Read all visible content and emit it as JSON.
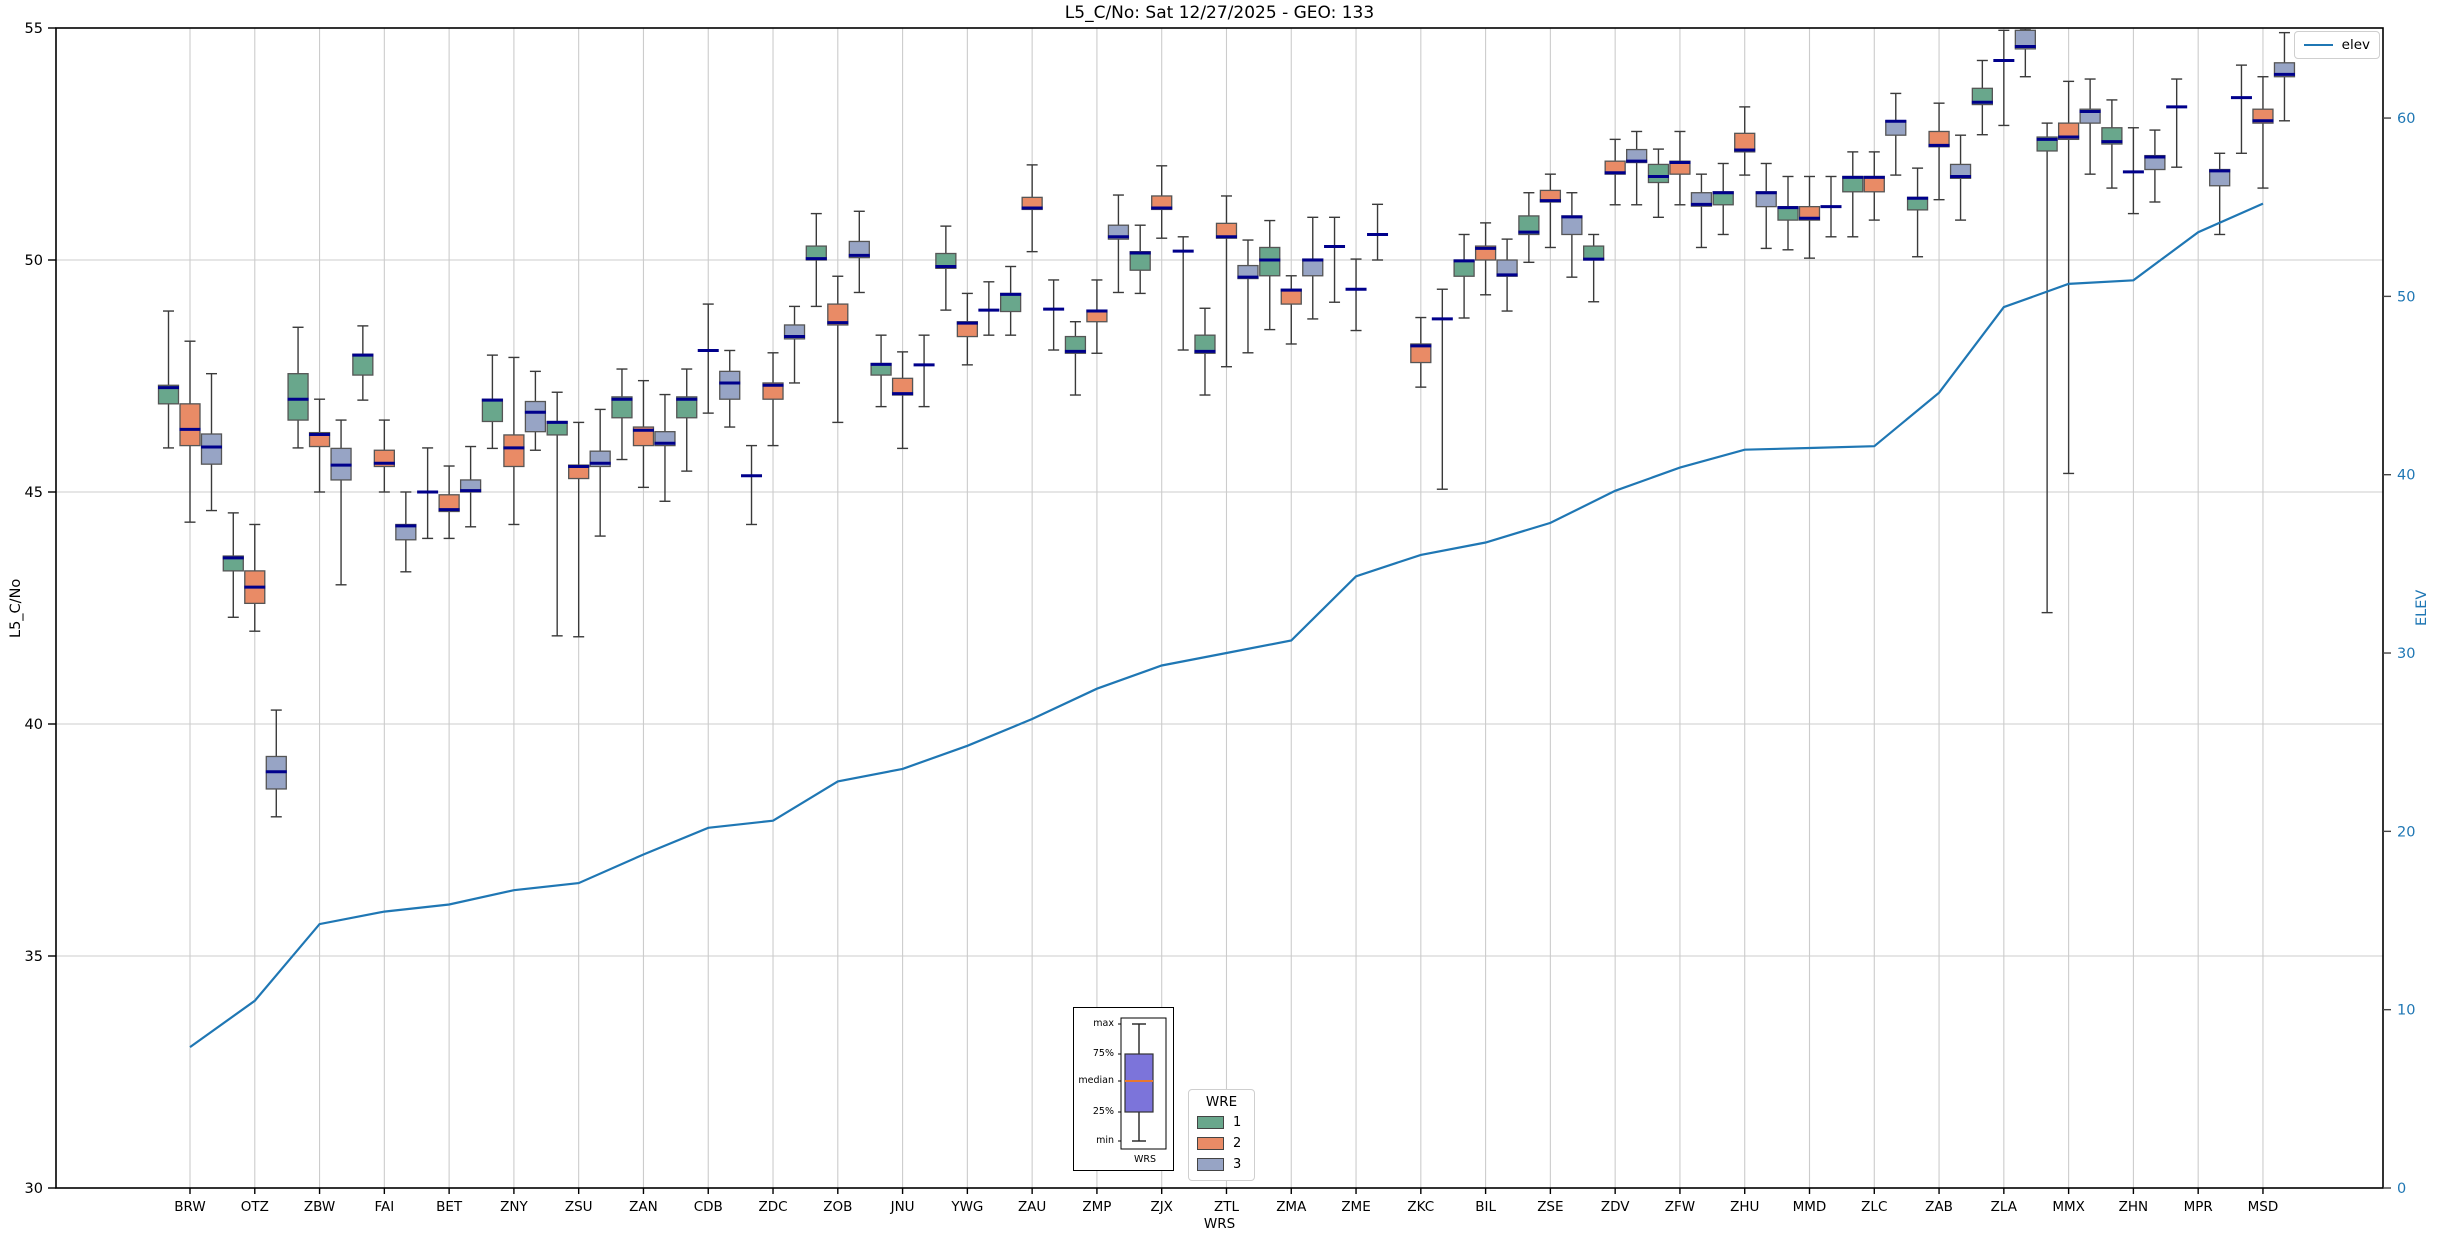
{
  "title": "L5_C/No: Sat 12/27/2025 - GEO: 133",
  "colors": {
    "wre1": "#69a78c",
    "wre2": "#e98b66",
    "wre3": "#97a4c5",
    "median": "#00008b",
    "whisker": "#3a3a3a",
    "box_edge": "#555555",
    "grid": "#cccccc",
    "elev_line": "#1f77b4",
    "right_axis_text": "#1f77b4",
    "inner_box_fill": "#7c74da",
    "inner_median": "#e8772e"
  },
  "legend_elev": {
    "label": "elev"
  },
  "legend_wre": {
    "title": "WRE",
    "items": [
      {
        "label": "1",
        "color_key": "wre1"
      },
      {
        "label": "2",
        "color_key": "wre2"
      },
      {
        "label": "3",
        "color_key": "wre3"
      }
    ]
  },
  "inner_legend": {
    "labels": {
      "max": "max",
      "p75": "75%",
      "median": "median",
      "p25": "25%",
      "min": "min",
      "xlabel": "WRS"
    }
  },
  "chart_data": {
    "type": "box",
    "title": "L5_C/No: Sat 12/27/2025 - GEO: 133",
    "xlabel": "WRS",
    "ylabel_left": "L5_C/No",
    "ylabel_right": "ELEV",
    "ylim_left": [
      30,
      55
    ],
    "ylim_right": [
      0,
      65.05
    ],
    "yticks_left": [
      30,
      35,
      40,
      45,
      50,
      55
    ],
    "yticks_right": [
      0,
      10,
      20,
      30,
      40,
      50,
      60
    ],
    "grid": true,
    "categories": [
      "BRW",
      "OTZ",
      "ZBW",
      "FAI",
      "BET",
      "ZNY",
      "ZSU",
      "ZAN",
      "CDB",
      "ZDC",
      "ZOB",
      "JNU",
      "YWG",
      "ZAU",
      "ZMP",
      "ZJX",
      "ZTL",
      "ZMA",
      "ZME",
      "ZKC",
      "BIL",
      "ZSE",
      "ZDV",
      "ZFW",
      "ZHU",
      "MMD",
      "ZLC",
      "ZAB",
      "ZLA",
      "MMX",
      "ZHN",
      "MPR",
      "MSD"
    ],
    "box_order": [
      "min",
      "q1",
      "median",
      "q3",
      "max"
    ],
    "series": [
      {
        "name": "1",
        "color_key": "wre1",
        "boxes": [
          [
            45.95,
            46.9,
            47.25,
            47.3,
            48.9
          ],
          [
            42.3,
            43.3,
            43.58,
            43.62,
            44.55
          ],
          [
            45.95,
            46.55,
            47.0,
            47.55,
            48.55
          ],
          [
            46.98,
            47.52,
            47.95,
            47.97,
            48.58
          ],
          [
            44.0,
            45.0,
            45.0,
            45.0,
            45.95
          ],
          [
            45.94,
            46.52,
            46.98,
            47.0,
            47.95
          ],
          [
            41.9,
            46.23,
            46.5,
            46.52,
            47.15
          ],
          [
            45.7,
            46.6,
            47.0,
            47.05,
            47.65
          ],
          [
            45.45,
            46.6,
            47.0,
            47.05,
            47.65
          ],
          [
            44.3,
            45.35,
            45.35,
            45.35,
            46.0
          ],
          [
            49.0,
            50.0,
            50.03,
            50.3,
            51.0
          ],
          [
            46.84,
            47.52,
            47.75,
            47.77,
            48.38
          ],
          [
            48.92,
            49.82,
            49.86,
            50.14,
            50.73
          ],
          [
            48.38,
            48.89,
            49.26,
            49.28,
            49.86
          ],
          [
            47.09,
            47.99,
            48.03,
            48.35,
            48.67
          ],
          [
            49.28,
            49.78,
            50.15,
            50.18,
            50.75
          ],
          [
            47.09,
            47.99,
            48.03,
            48.38,
            48.96
          ],
          [
            48.5,
            49.66,
            50.0,
            50.27,
            50.85
          ],
          [
            49.09,
            50.29,
            50.29,
            50.29,
            50.92
          ],
          null,
          [
            48.75,
            49.65,
            49.98,
            50.0,
            50.55
          ],
          [
            49.95,
            50.55,
            50.6,
            50.95,
            51.45
          ],
          [
            49.1,
            50.0,
            50.02,
            50.3,
            50.55
          ],
          [
            50.92,
            51.67,
            51.8,
            52.06,
            52.39
          ],
          [
            50.55,
            51.19,
            51.45,
            51.47,
            52.08
          ],
          [
            50.22,
            50.86,
            51.13,
            51.15,
            51.8
          ],
          [
            50.5,
            51.47,
            51.78,
            51.8,
            52.33
          ],
          [
            50.07,
            51.08,
            51.33,
            51.35,
            51.98
          ],
          [
            52.7,
            53.35,
            53.4,
            53.7,
            54.3
          ],
          [
            42.4,
            52.35,
            52.6,
            52.65,
            52.95
          ],
          [
            51.55,
            52.5,
            52.55,
            52.85,
            53.45
          ],
          [
            52.0,
            53.3,
            53.3,
            53.3,
            53.9
          ],
          [
            52.3,
            53.5,
            53.5,
            53.5,
            54.2
          ]
        ]
      },
      {
        "name": "2",
        "color_key": "wre2",
        "boxes": [
          [
            44.35,
            46.0,
            46.35,
            46.9,
            48.25
          ],
          [
            42.0,
            42.6,
            42.95,
            43.3,
            44.3
          ],
          [
            45.0,
            45.98,
            46.24,
            46.28,
            47.0
          ],
          [
            45.0,
            45.55,
            45.62,
            45.9,
            46.55
          ],
          [
            44.0,
            44.58,
            44.62,
            44.94,
            45.56
          ],
          [
            44.3,
            45.55,
            45.95,
            46.23,
            47.9
          ],
          [
            41.88,
            45.29,
            45.55,
            45.58,
            46.5
          ],
          [
            45.1,
            46.0,
            46.33,
            46.4,
            47.4
          ],
          [
            46.7,
            48.05,
            48.05,
            48.05,
            49.05
          ],
          [
            46.0,
            47.0,
            47.3,
            47.35,
            48.0
          ],
          [
            46.5,
            48.6,
            48.65,
            49.05,
            49.65
          ],
          [
            45.94,
            47.09,
            47.12,
            47.45,
            48.02
          ],
          [
            47.74,
            48.35,
            48.64,
            48.67,
            49.28
          ],
          [
            50.18,
            51.09,
            51.12,
            51.35,
            52.05
          ],
          [
            47.99,
            48.67,
            48.9,
            48.92,
            49.57
          ],
          [
            50.47,
            51.09,
            51.12,
            51.38,
            52.03
          ],
          [
            47.7,
            50.47,
            50.5,
            50.79,
            51.38
          ],
          [
            48.19,
            49.05,
            49.35,
            49.37,
            49.66
          ],
          [
            48.48,
            49.37,
            49.37,
            49.37,
            50.02
          ],
          [
            47.26,
            47.79,
            48.15,
            48.19,
            48.76
          ],
          [
            49.25,
            50.0,
            50.25,
            50.3,
            50.8
          ],
          [
            50.27,
            51.25,
            51.28,
            51.5,
            51.85
          ],
          [
            51.19,
            51.85,
            51.88,
            52.13,
            52.6
          ],
          [
            51.19,
            51.85,
            52.1,
            52.13,
            52.77
          ],
          [
            51.83,
            52.33,
            52.37,
            52.73,
            53.3
          ],
          [
            50.04,
            50.86,
            50.9,
            51.15,
            51.8
          ],
          [
            50.86,
            51.47,
            51.78,
            51.8,
            52.33
          ],
          [
            51.3,
            52.44,
            52.47,
            52.77,
            53.38
          ],
          [
            52.9,
            54.3,
            54.3,
            54.3,
            54.95
          ],
          [
            45.4,
            52.6,
            52.65,
            52.95,
            53.85
          ],
          [
            51.0,
            51.9,
            51.9,
            51.9,
            52.85
          ],
          null,
          [
            51.55,
            52.95,
            53.0,
            53.25,
            53.95
          ]
        ]
      },
      {
        "name": "3",
        "color_key": "wre3",
        "boxes": [
          [
            44.6,
            45.6,
            45.97,
            46.25,
            47.55
          ],
          [
            38.0,
            38.6,
            38.97,
            39.3,
            40.3
          ],
          [
            43.0,
            45.26,
            45.58,
            45.94,
            46.55
          ],
          [
            43.28,
            43.97,
            44.27,
            44.3,
            45.0
          ],
          [
            44.25,
            45.0,
            45.03,
            45.26,
            45.98
          ],
          [
            45.9,
            46.3,
            46.72,
            46.95,
            47.6
          ],
          [
            44.05,
            45.55,
            45.62,
            45.88,
            46.78
          ],
          [
            44.8,
            46.0,
            46.05,
            46.3,
            47.1
          ],
          [
            46.4,
            47.0,
            47.35,
            47.6,
            48.05
          ],
          [
            47.35,
            48.3,
            48.35,
            48.6,
            49.0
          ],
          [
            49.3,
            50.05,
            50.1,
            50.4,
            51.05
          ],
          [
            46.84,
            47.74,
            47.74,
            47.74,
            48.38
          ],
          [
            48.38,
            48.92,
            48.92,
            48.92,
            49.53
          ],
          [
            48.06,
            48.94,
            48.94,
            48.94,
            49.57
          ],
          [
            49.3,
            50.45,
            50.5,
            50.75,
            51.4
          ],
          [
            48.06,
            50.19,
            50.19,
            50.19,
            50.5
          ],
          [
            48.0,
            49.6,
            49.63,
            49.88,
            50.43
          ],
          [
            48.73,
            49.66,
            50.0,
            50.02,
            50.92
          ],
          [
            50.0,
            50.55,
            50.55,
            50.55,
            51.2
          ],
          [
            45.06,
            48.73,
            48.73,
            48.73,
            49.37
          ],
          [
            48.9,
            49.65,
            49.68,
            50.0,
            50.45
          ],
          [
            49.63,
            50.55,
            50.93,
            50.95,
            51.45
          ],
          [
            51.19,
            52.1,
            52.13,
            52.38,
            52.77
          ],
          [
            50.27,
            51.16,
            51.2,
            51.45,
            51.85
          ],
          [
            50.25,
            51.15,
            51.45,
            51.47,
            52.08
          ],
          [
            50.5,
            51.15,
            51.15,
            51.15,
            51.8
          ],
          [
            51.83,
            52.69,
            52.99,
            53.0,
            53.59
          ],
          [
            50.86,
            51.76,
            51.8,
            52.06,
            52.69
          ],
          [
            53.95,
            54.55,
            54.6,
            54.95,
            54.98
          ],
          [
            51.85,
            52.95,
            53.2,
            53.25,
            53.9
          ],
          [
            51.25,
            51.95,
            52.22,
            52.25,
            52.8
          ],
          [
            50.55,
            51.6,
            51.92,
            51.95,
            52.3
          ],
          [
            53.0,
            53.95,
            54.0,
            54.25,
            54.9
          ]
        ]
      }
    ],
    "line": {
      "name": "elev",
      "axis": "right",
      "values": [
        7.9,
        10.5,
        14.8,
        15.5,
        15.9,
        16.7,
        17.1,
        18.7,
        20.2,
        20.6,
        22.8,
        23.5,
        24.8,
        26.3,
        28.0,
        29.3,
        30.0,
        30.7,
        34.3,
        35.5,
        36.2,
        37.3,
        39.1,
        40.4,
        41.4,
        41.5,
        41.6,
        44.6,
        49.4,
        50.7,
        50.9,
        53.6,
        55.2
      ]
    },
    "legend_position": "WRE bottom-center, elev top-right"
  }
}
